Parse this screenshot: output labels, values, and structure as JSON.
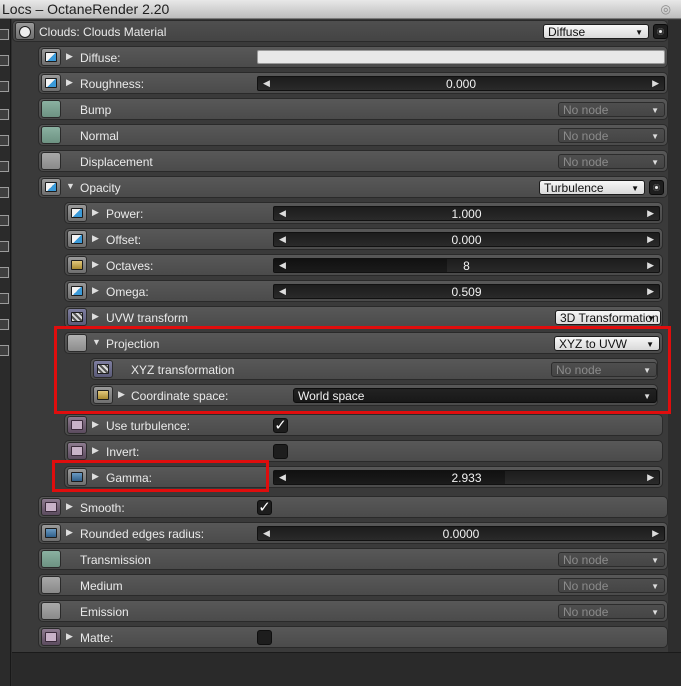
{
  "window": {
    "title": "Locs – OctaneRender 2.20"
  },
  "material": {
    "name": "Clouds: Clouds Material",
    "type": "Diffuse"
  },
  "params": {
    "diffuse": {
      "label": "Diffuse:"
    },
    "roughness": {
      "label": "Roughness:",
      "value": "0.000"
    },
    "bump": {
      "label": "Bump",
      "node": "No node"
    },
    "normal": {
      "label": "Normal",
      "node": "No node"
    },
    "displacement": {
      "label": "Displacement",
      "node": "No node"
    },
    "opacity": {
      "label": "Opacity",
      "texture": "Turbulence"
    },
    "power": {
      "label": "Power:",
      "value": "1.000"
    },
    "offset": {
      "label": "Offset:",
      "value": "0.000"
    },
    "octaves": {
      "label": "Octaves:",
      "value": "8",
      "fill": 0.45
    },
    "omega": {
      "label": "Omega:",
      "value": "0.509"
    },
    "uvw": {
      "label": "UVW transform",
      "value": "3D Transformation"
    },
    "projection": {
      "label": "Projection",
      "value": "XYZ to UVW"
    },
    "xyz": {
      "label": "XYZ transformation",
      "node": "No node"
    },
    "coord": {
      "label": "Coordinate space:",
      "value": "World space"
    },
    "use_turbulence": {
      "label": "Use turbulence:",
      "checked": "✓"
    },
    "invert": {
      "label": "Invert:"
    },
    "gamma": {
      "label": "Gamma:",
      "value": "2.933",
      "fill": 0.6
    },
    "smooth": {
      "label": "Smooth:",
      "checked": "✓"
    },
    "rounded": {
      "label": "Rounded edges radius:",
      "value": "0.0000"
    },
    "transmission": {
      "label": "Transmission",
      "node": "No node"
    },
    "medium": {
      "label": "Medium",
      "node": "No node"
    },
    "emission": {
      "label": "Emission",
      "node": "No node"
    },
    "matte": {
      "label": "Matte:"
    }
  },
  "glyphs": {
    "right_arrow": "▶",
    "down_arrow": "▼",
    "left_arrow": "◀",
    "caret": "▼",
    "close": "◎"
  },
  "colors": {
    "highlight": "#e00d0d",
    "accent": "#3a9ad9"
  }
}
